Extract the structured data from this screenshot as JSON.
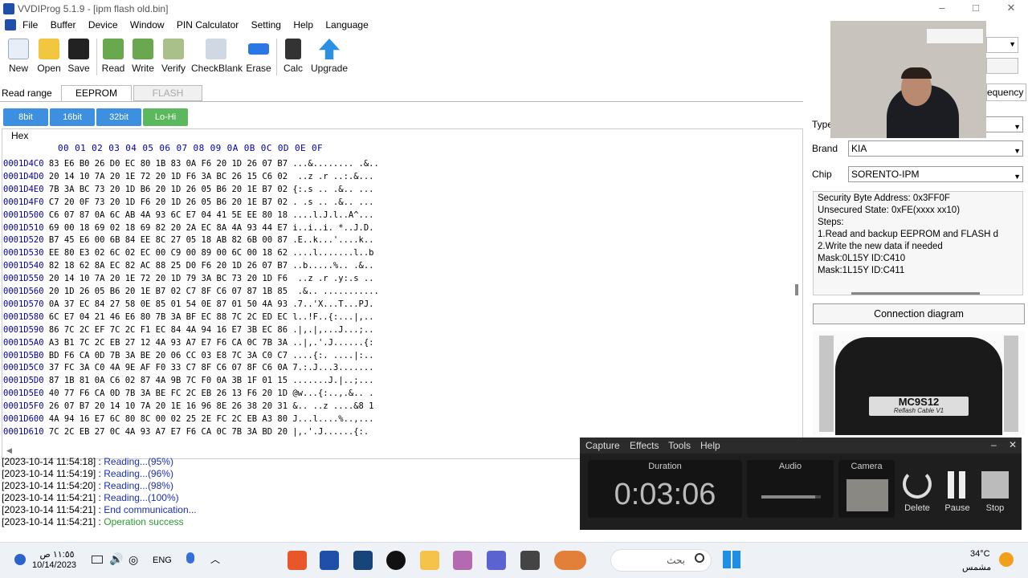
{
  "window": {
    "title": "VVDIProg 5.1.9 - [ipm flash old.bin]",
    "minimize": "–",
    "maximize": "□",
    "close": "✕"
  },
  "menu": [
    "File",
    "Buffer",
    "Device",
    "Window",
    "PIN Calculator",
    "Setting",
    "Help",
    "Language"
  ],
  "toolbar": [
    {
      "label": "New",
      "icon": "new-file-icon",
      "color": "#e8eef7"
    },
    {
      "label": "Open",
      "icon": "folder-icon",
      "color": "#f3c63f"
    },
    {
      "label": "Save",
      "icon": "save-icon",
      "color": "#222"
    },
    {
      "label": "Read",
      "icon": "read-chip-icon",
      "color": "#6aa84f"
    },
    {
      "label": "Write",
      "icon": "write-chip-icon",
      "color": "#6aa84f"
    },
    {
      "label": "Verify",
      "icon": "verify-chip-icon",
      "color": "#a9c08a"
    },
    {
      "label": "CheckBlank",
      "icon": "checkblank-icon",
      "color": "#cfd8e3"
    },
    {
      "label": "Erase",
      "icon": "erase-icon",
      "color": "#2b78e4"
    },
    {
      "label": "Calc",
      "icon": "calculator-icon",
      "color": "#333"
    },
    {
      "label": "Upgrade",
      "icon": "upgrade-arrow-icon",
      "color": "#2b8fe4"
    }
  ],
  "read_range": {
    "label": "Read range",
    "tabs": [
      "EEPROM",
      "FLASH"
    ],
    "active": "EEPROM"
  },
  "bit_buttons": [
    {
      "label": "8bit",
      "color": "#3d8fe0"
    },
    {
      "label": "16bit",
      "color": "#3d8fe0"
    },
    {
      "label": "32bit",
      "color": "#3d8fe0"
    },
    {
      "label": "Lo-Hi",
      "color": "#5cb85c"
    }
  ],
  "hex": {
    "group_label": "Hex",
    "header": "00 01 02 03 04 05 06 07 08 09 0A 0B 0C 0D 0E 0F",
    "rows": [
      {
        "addr": "0001D4C0",
        "bytes": "83 E6 B0 26 D0 EC 80 1B 83 0A F6 20 1D 26 07 B7",
        "ascii": "...&........ .&.."
      },
      {
        "addr": "0001D4D0",
        "bytes": "20 14 10 7A 20 1E 72 20 1D F6 3A BC 26 15 C6 02",
        "ascii": " ..z .r ..:.&..."
      },
      {
        "addr": "0001D4E0",
        "bytes": "7B 3A BC 73 20 1D B6 20 1D 26 05 B6 20 1E B7 02",
        "ascii": "{:.s .. .&.. ..."
      },
      {
        "addr": "0001D4F0",
        "bytes": "C7 20 0F 73 20 1D F6 20 1D 26 05 B6 20 1E B7 02",
        "ascii": ". .s .. .&.. ..."
      },
      {
        "addr": "0001D500",
        "bytes": "C6 07 87 0A 6C AB 4A 93 6C E7 04 41 5E EE 80 18",
        "ascii": "....l.J.l..A^..."
      },
      {
        "addr": "0001D510",
        "bytes": "69 00 18 69 02 18 69 82 20 2A EC 8A 4A 93 44 E7",
        "ascii": "i..i..i. *..J.D."
      },
      {
        "addr": "0001D520",
        "bytes": "B7 45 E6 00 6B 84 EE 8C 27 05 18 AB 82 6B 00 87",
        "ascii": ".E..k...'....k.."
      },
      {
        "addr": "0001D530",
        "bytes": "EE 80 E3 02 6C 02 EC 00 C9 00 89 00 6C 00 18 62",
        "ascii": "....l.......l..b"
      },
      {
        "addr": "0001D540",
        "bytes": "82 18 62 8A EC 82 AC 88 25 D0 F6 20 1D 26 07 B7",
        "ascii": "..b.....%.. .&.."
      },
      {
        "addr": "0001D550",
        "bytes": "20 14 10 7A 20 1E 72 20 1D 79 3A BC 73 20 1D F6",
        "ascii": " ..z .r .y:.s .."
      },
      {
        "addr": "0001D560",
        "bytes": "20 1D 26 05 B6 20 1E B7 02 C7 8F C6 07 87 1B 85",
        "ascii": " .&.. ..........."
      },
      {
        "addr": "0001D570",
        "bytes": "0A 37 EC 84 27 58 0E 85 01 54 0E 87 01 50 4A 93",
        "ascii": ".7..'X...T...PJ."
      },
      {
        "addr": "0001D580",
        "bytes": "6C E7 04 21 46 E6 80 7B 3A BF EC 88 7C 2C ED EC",
        "ascii": "l..!F..{:...|,.."
      },
      {
        "addr": "0001D590",
        "bytes": "86 7C 2C EF 7C 2C F1 EC 84 4A 94 16 E7 3B EC 86",
        "ascii": ".|,.|,...J...;.."
      },
      {
        "addr": "0001D5A0",
        "bytes": "A3 B1 7C 2C EB 27 12 4A 93 A7 E7 F6 CA 0C 7B 3A",
        "ascii": "..|,.'.J......{:"
      },
      {
        "addr": "0001D5B0",
        "bytes": "BD F6 CA 0D 7B 3A BE 20 06 CC 03 E8 7C 3A C0 C7",
        "ascii": "....{:. ....|:.."
      },
      {
        "addr": "0001D5C0",
        "bytes": "37 FC 3A C0 4A 9E AF F0 33 C7 8F C6 07 8F C6 0A",
        "ascii": "7.:.J...3......."
      },
      {
        "addr": "0001D5D0",
        "bytes": "87 1B 81 0A C6 02 87 4A 9B 7C F0 0A 3B 1F 01 15",
        "ascii": ".......J.|..;..."
      },
      {
        "addr": "0001D5E0",
        "bytes": "40 77 F6 CA 0D 7B 3A BE FC 2C EB 26 13 F6 20 1D",
        "ascii": "@w...{:..,.&.. ."
      },
      {
        "addr": "0001D5F0",
        "bytes": "26 07 B7 20 14 10 7A 20 1E 16 96 8E 26 38 20 31",
        "ascii": "&.. ..z ....&8 1"
      },
      {
        "addr": "0001D600",
        "bytes": "4A 94 16 E7 6C 80 8C 00 02 25 2E FC 2C EB A3 80",
        "ascii": "J...l....%..,..."
      },
      {
        "addr": "0001D610",
        "bytes": "7C 2C EB 27 0C 4A 93 A7 E7 F6 CA 0C 7B 3A BD 20",
        "ascii": "|,.'.J......{:."
      }
    ]
  },
  "log": [
    {
      "time": "[2023-10-14 11:54:18]",
      "msg": "Reading...(95%)",
      "color": "#1a2fb5"
    },
    {
      "time": "[2023-10-14 11:54:19]",
      "msg": "Reading...(96%)",
      "color": "#1a2fb5"
    },
    {
      "time": "[2023-10-14 11:54:20]",
      "msg": "Reading...(98%)",
      "color": "#1a2fb5"
    },
    {
      "time": "[2023-10-14 11:54:21]",
      "msg": "Reading...(100%)",
      "color": "#1a2fb5"
    },
    {
      "time": "[2023-10-14 11:54:21]",
      "msg": "End communication...",
      "color": "#1a2fb5"
    },
    {
      "time": "[2023-10-14 11:54:21]",
      "msg": "Operation success",
      "color": "#2e9b2e"
    }
  ],
  "right": {
    "type_label": "Type",
    "brand_label": "Brand",
    "brand_value": "KIA",
    "chip_label": "Chip",
    "chip_value": "SORENTO-IPM",
    "frequency_label": "equency",
    "info": [
      "Security Byte Address: 0x3FF0F",
      "Unsecured State: 0xFE(xxxx xx10)",
      "Steps:",
      "1.Read and backup EEPROM and FLASH d",
      "2.Write the new data if needed",
      "Mask:0L15Y ID:C410",
      "Mask:1L15Y ID:C411"
    ],
    "connection_button": "Connection diagram",
    "cable_title": "MC9S12",
    "cable_subtitle": "Reflash Cable V1"
  },
  "recorder": {
    "menu": [
      "Capture",
      "Effects",
      "Tools",
      "Help"
    ],
    "duration_label": "Duration",
    "duration": "0:03:06",
    "audio_label": "Audio",
    "audio_level": 0.9,
    "camera_label": "Camera",
    "delete": "Delete",
    "pause": "Pause",
    "stop": "Stop"
  },
  "taskbar": {
    "time": "١١:٥٥ ص",
    "date": "10/14/2023",
    "lang": "ENG",
    "search": "بحث",
    "temp": "34°C",
    "weather": "مشمس"
  }
}
